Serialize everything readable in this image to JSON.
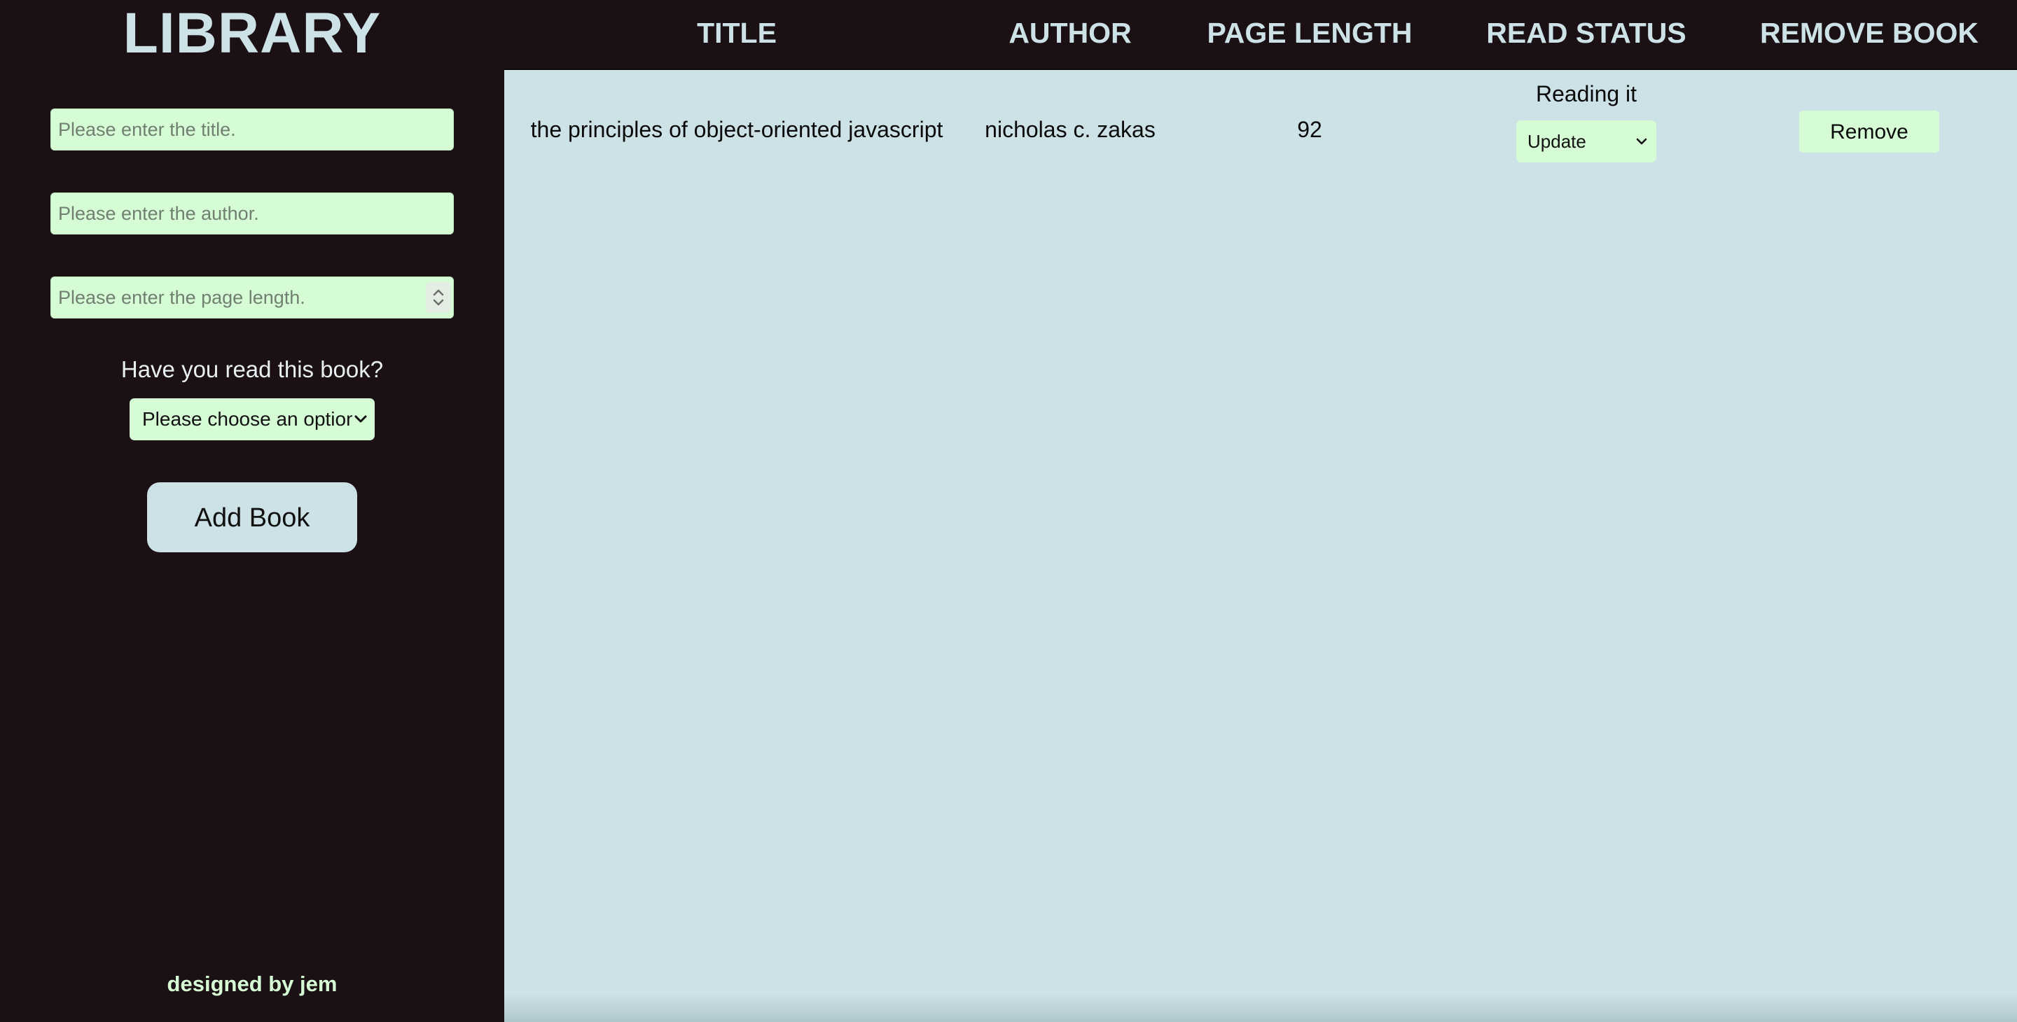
{
  "sidebar": {
    "logo": "LIBRARY",
    "title_placeholder": "Please enter the title.",
    "author_placeholder": "Please enter the author.",
    "pages_placeholder": "Please enter the page length.",
    "read_question": "Have you read this book?",
    "read_select_value": "Please choose an option",
    "add_button": "Add Book",
    "footer": "designed by jem"
  },
  "table": {
    "headers": {
      "title": "TITLE",
      "author": "AUTHOR",
      "pages": "PAGE LENGTH",
      "status": "READ STATUS",
      "remove": "REMOVE BOOK"
    },
    "rows": [
      {
        "title": "the principles of object-oriented javascript",
        "author": "nicholas c. zakas",
        "pages": "92",
        "status": "Reading it",
        "update_select": "Update",
        "remove_button": "Remove"
      }
    ]
  },
  "colors": {
    "background_dark": "#1b1115",
    "panel_light": "#cde2e6",
    "input_green": "#d6fcd5",
    "footer_green": "#d6fcd5"
  },
  "icons": {
    "stepper": "stepper-arrows-icon",
    "select": "chevron-down-icon"
  }
}
